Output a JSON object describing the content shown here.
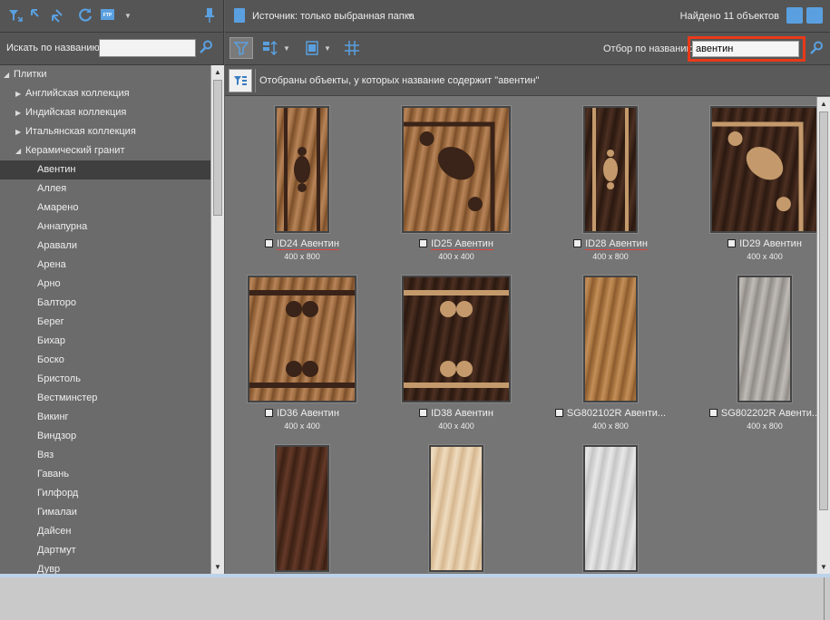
{
  "left_search": {
    "label": "Искать по названию",
    "value": ""
  },
  "left_toolbar": {
    "icons": [
      "filter-dn-icon",
      "expand-icon",
      "collapse-icon",
      "refresh-icon",
      "ftp-icon",
      "dropdown-icon",
      "pin-icon"
    ]
  },
  "tree": {
    "items": [
      {
        "label": "Плитки",
        "level": 0,
        "arrow": "open"
      },
      {
        "label": "Английская коллекция",
        "level": 1,
        "arrow": "closed"
      },
      {
        "label": "Индийская коллекция",
        "level": 1,
        "arrow": "closed"
      },
      {
        "label": "Итальянская коллекция",
        "level": 1,
        "arrow": "closed"
      },
      {
        "label": "Керамический гранит",
        "level": 1,
        "arrow": "open"
      },
      {
        "label": "Авентин",
        "level": 2,
        "selected": true
      },
      {
        "label": "Аллея",
        "level": 2
      },
      {
        "label": "Амарено",
        "level": 2
      },
      {
        "label": "Аннапурна",
        "level": 2
      },
      {
        "label": "Аравали",
        "level": 2
      },
      {
        "label": "Арена",
        "level": 2
      },
      {
        "label": "Арно",
        "level": 2
      },
      {
        "label": "Балторо",
        "level": 2
      },
      {
        "label": "Берег",
        "level": 2
      },
      {
        "label": "Бихар",
        "level": 2
      },
      {
        "label": "Боско",
        "level": 2
      },
      {
        "label": "Бристоль",
        "level": 2
      },
      {
        "label": "Вестминстер",
        "level": 2
      },
      {
        "label": "Викинг",
        "level": 2
      },
      {
        "label": "Виндзор",
        "level": 2
      },
      {
        "label": "Вяз",
        "level": 2
      },
      {
        "label": "Гавань",
        "level": 2
      },
      {
        "label": "Гилфорд",
        "level": 2
      },
      {
        "label": "Гималаи",
        "level": 2
      },
      {
        "label": "Дайсен",
        "level": 2
      },
      {
        "label": "Дартмут",
        "level": 2
      },
      {
        "label": "Дувр",
        "level": 2
      }
    ]
  },
  "header": {
    "source_label": "Источник: только выбранная папка",
    "found_label": "Найдено 11 объектов"
  },
  "toolbar": {
    "filter_label": "Отбор по названию",
    "filter_value": "авентин"
  },
  "info": {
    "text": "Отобраны объекты, у которых название содержит \"авентин\""
  },
  "tiles": [
    {
      "name": "ID24 Авентин",
      "size": "400 x 800",
      "underline": true,
      "style": "dec-rect-light"
    },
    {
      "name": "ID25 Авентин",
      "size": "400 x 400",
      "underline": true,
      "style": "dec-sq-light"
    },
    {
      "name": "ID28 Авентин",
      "size": "400 x 800",
      "underline": true,
      "style": "dec-rect-dark"
    },
    {
      "name": "ID29 Авентин",
      "size": "400 x 400",
      "underline": false,
      "style": "dec-sq-dark"
    },
    {
      "name": "ID36 Авентин",
      "size": "400 x 400",
      "underline": false,
      "style": "border-light"
    },
    {
      "name": "ID38 Авентин",
      "size": "400 x 400",
      "underline": false,
      "style": "border-dark"
    },
    {
      "name": "SG802102R Авенти...",
      "size": "400 x 800",
      "underline": false,
      "style": "plain-wood"
    },
    {
      "name": "SG802202R Авенти...",
      "size": "400 x 800",
      "underline": false,
      "style": "plain-grey"
    },
    {
      "name": "",
      "size": "",
      "underline": false,
      "style": "plain-dark"
    },
    {
      "name": "",
      "size": "",
      "underline": false,
      "style": "plain-cream"
    },
    {
      "name": "",
      "size": "",
      "underline": false,
      "style": "plain-white"
    }
  ],
  "colors": {
    "accent": "#5aa0e0",
    "highlight_border": "#e83a1a",
    "selected_row": "#3f3f3f"
  }
}
